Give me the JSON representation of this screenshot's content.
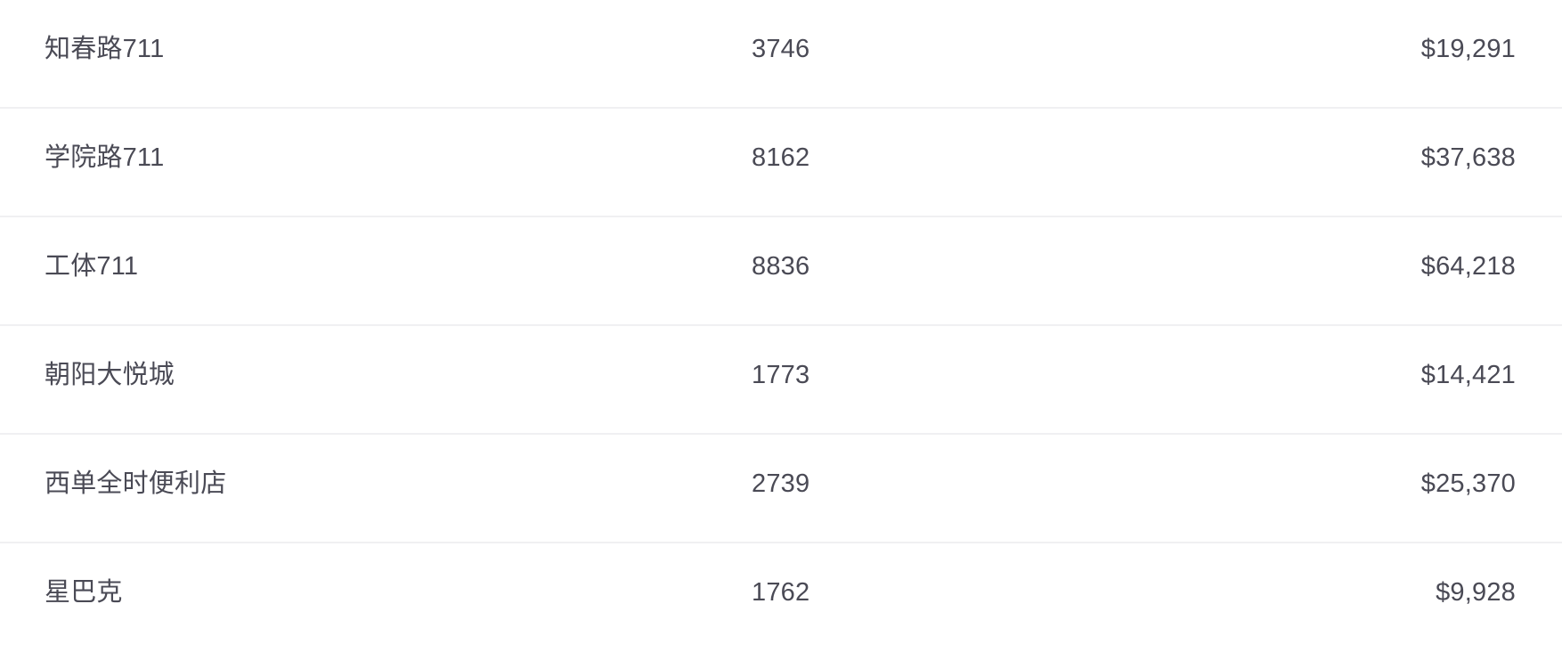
{
  "table": {
    "rows": [
      {
        "name": "知春路711",
        "count": "3746",
        "amount": "$19,291"
      },
      {
        "name": "学院路711",
        "count": "8162",
        "amount": "$37,638"
      },
      {
        "name": "工体711",
        "count": "8836",
        "amount": "$64,218"
      },
      {
        "name": "朝阳大悦城",
        "count": "1773",
        "amount": "$14,421"
      },
      {
        "name": "西单全时便利店",
        "count": "2739",
        "amount": "$25,370"
      },
      {
        "name": "星巴克",
        "count": "1762",
        "amount": "$9,928"
      }
    ]
  }
}
